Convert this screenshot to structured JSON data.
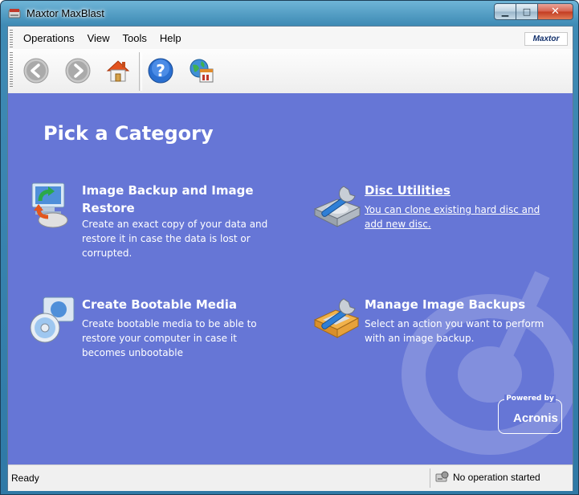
{
  "window": {
    "title": "Maxtor MaxBlast"
  },
  "menu": [
    "Operations",
    "View",
    "Tools",
    "Help"
  ],
  "brand": "Maxtor",
  "toolbar": [
    "back-icon",
    "forward-icon",
    "home-icon",
    "help-icon",
    "web-icon"
  ],
  "page": {
    "heading": "Pick a Category"
  },
  "categories": [
    {
      "title": "Image Backup and Image Restore",
      "desc": "Create an exact copy of your data and restore it in case the data is lost or corrupted.",
      "icon": "backup-restore-icon"
    },
    {
      "title": "Disc Utilities",
      "desc": "You can clone existing hard disc and add new disc.",
      "icon": "disc-utilities-icon"
    },
    {
      "title": "Create Bootable Media",
      "desc": "Create bootable media to be able to restore your computer in case it becomes unbootable",
      "icon": "bootable-media-icon"
    },
    {
      "title": "Manage Image Backups",
      "desc": "Select an action you want to perform with an image backup.",
      "icon": "manage-backups-icon"
    }
  ],
  "powered_by": {
    "line1": "Powered by",
    "line2": "Acronis"
  },
  "status": {
    "left": "Ready",
    "right": "No operation started"
  },
  "colors": {
    "content_bg": "#6676d6",
    "title_bar": "#3f8bb5"
  }
}
